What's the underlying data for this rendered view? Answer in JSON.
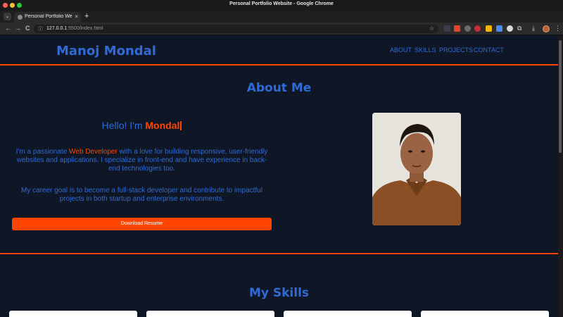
{
  "window": {
    "title": "Personal Portfolio Website - Google Chrome"
  },
  "tab": {
    "title": "Personal Portfolio Website",
    "close": "×",
    "new": "+"
  },
  "toolbar": {
    "back": "←",
    "forward": "→",
    "reload": "C",
    "url_host": "127.0.0.1",
    "url_rest": ":5500/index.html",
    "colors": {
      "accent": "#ff4500",
      "brand": "#2f6ad6"
    }
  },
  "site": {
    "brand": "Manoj Mondal",
    "nav": [
      "ABOUT",
      "SKILLS",
      "PROJECTS",
      "CONTACT"
    ]
  },
  "about": {
    "title": "About Me",
    "hello_prefix": "Hello! I'm ",
    "hello_name": "Mondal",
    "p1_prefix": "I'm a passionate ",
    "p1_highlight": "Web Developer",
    "p1_suffix": " with a love for building responsive, user-friendly websites and applications. I specialize in front-end and have experience in back-end technologies too.",
    "p2": "My career goal is to become a full-stack developer and contribute to impactful projects in both startup and enterprise environments.",
    "download_label": "Download Resume"
  },
  "skills": {
    "title": "My Skills"
  }
}
